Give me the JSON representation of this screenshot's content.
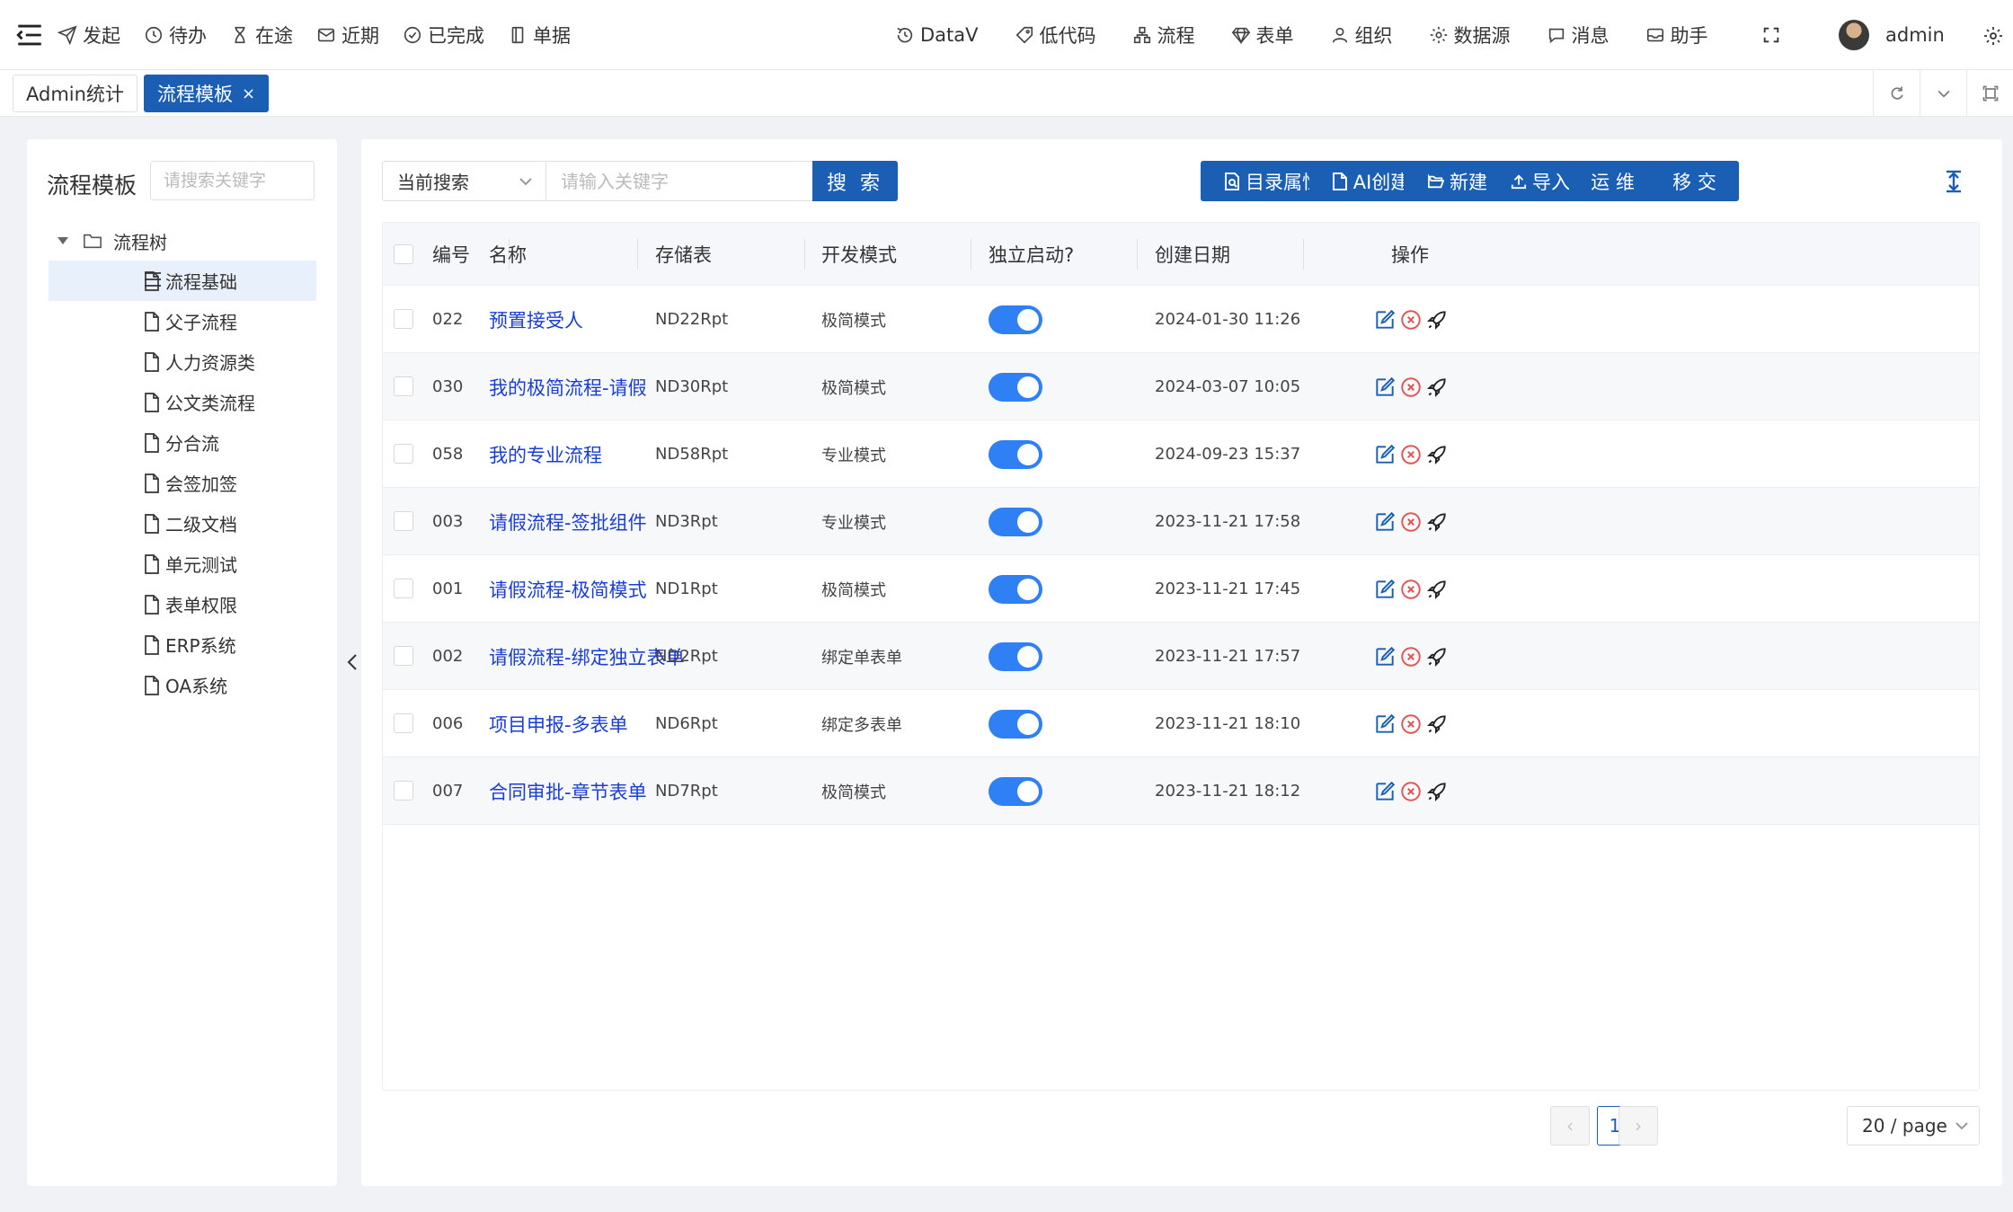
{
  "topnav": {
    "left": [
      {
        "label": "发起",
        "icon": "send-icon"
      },
      {
        "label": "待办",
        "icon": "clock-icon"
      },
      {
        "label": "在途",
        "icon": "hourglass-icon"
      },
      {
        "label": "近期",
        "icon": "mail-icon"
      },
      {
        "label": "已完成",
        "icon": "check-circle-icon"
      },
      {
        "label": "单据",
        "icon": "document-icon"
      }
    ],
    "right": [
      {
        "label": "DataV",
        "icon": "history-icon"
      },
      {
        "label": "低代码",
        "icon": "tag-icon"
      },
      {
        "label": "流程",
        "icon": "flow-icon"
      },
      {
        "label": "表单",
        "icon": "diamond-icon"
      },
      {
        "label": "组织",
        "icon": "user-icon"
      },
      {
        "label": "数据源",
        "icon": "gear-icon"
      },
      {
        "label": "消息",
        "icon": "chat-icon"
      },
      {
        "label": "助手",
        "icon": "inbox-icon"
      }
    ],
    "user": "admin"
  },
  "tabs": {
    "items": [
      {
        "label": "Admin统计"
      },
      {
        "label": "流程模板",
        "close": "×"
      }
    ]
  },
  "sidebar": {
    "title": "流程模板",
    "search_placeholder": "请搜索关键字",
    "root": "流程树",
    "items": [
      {
        "label": "流程基础"
      },
      {
        "label": "父子流程"
      },
      {
        "label": "人力资源类"
      },
      {
        "label": "公文类流程"
      },
      {
        "label": "分合流"
      },
      {
        "label": "会签加签"
      },
      {
        "label": "二级文档"
      },
      {
        "label": "单元测试"
      },
      {
        "label": "表单权限"
      },
      {
        "label": "ERP系统"
      },
      {
        "label": "OA系统"
      }
    ]
  },
  "toolbar": {
    "select_value": "当前搜索",
    "search_placeholder": "请输入关键字",
    "search_label": "搜 索",
    "buttons": [
      {
        "label": "目录属性"
      },
      {
        "label": "AI创建"
      },
      {
        "label": "新建"
      },
      {
        "label": "导入"
      },
      {
        "label": "运 维"
      },
      {
        "label": "移 交"
      }
    ]
  },
  "table": {
    "headers": [
      "编号",
      "名称",
      "存储表",
      "开发模式",
      "独立启动?",
      "创建日期",
      "操作"
    ],
    "rows": [
      {
        "no": "022",
        "name": "预置接受人",
        "table": "ND22Rpt",
        "mode": "极简模式",
        "enabled": true,
        "date": "2024-01-30 11:26"
      },
      {
        "no": "030",
        "name": "我的极简流程-请假",
        "table": "ND30Rpt",
        "mode": "极简模式",
        "enabled": true,
        "date": "2024-03-07 10:05"
      },
      {
        "no": "058",
        "name": "我的专业流程",
        "table": "ND58Rpt",
        "mode": "专业模式",
        "enabled": true,
        "date": "2024-09-23 15:37"
      },
      {
        "no": "003",
        "name": "请假流程-签批组件",
        "table": "ND3Rpt",
        "mode": "专业模式",
        "enabled": true,
        "date": "2023-11-21 17:58"
      },
      {
        "no": "001",
        "name": "请假流程-极简模式",
        "table": "ND1Rpt",
        "mode": "极简模式",
        "enabled": true,
        "date": "2023-11-21 17:45"
      },
      {
        "no": "002",
        "name": "请假流程-绑定独立表单",
        "table": "ND2Rpt",
        "mode": "绑定单表单",
        "enabled": true,
        "date": "2023-11-21 17:57"
      },
      {
        "no": "006",
        "name": "项目申报-多表单",
        "table": "ND6Rpt",
        "mode": "绑定多表单",
        "enabled": true,
        "date": "2023-11-21 18:10"
      },
      {
        "no": "007",
        "name": "合同审批-章节表单",
        "table": "ND7Rpt",
        "mode": "极简模式",
        "enabled": true,
        "date": "2023-11-21 18:12"
      }
    ]
  },
  "pagination": {
    "prev": "‹",
    "page": "1",
    "next": "›",
    "size": "20 / page"
  },
  "colors": {
    "primary": "#1a5fb4",
    "link": "#1a3dd6",
    "toggle_on": "#2f7ff5",
    "danger": "#e05555"
  }
}
